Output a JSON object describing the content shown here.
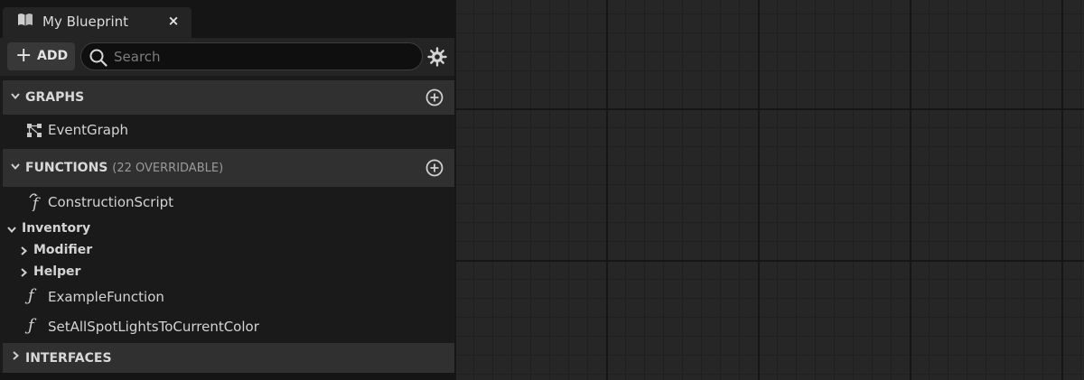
{
  "tab": {
    "title": "My Blueprint",
    "icon": "book-icon",
    "close_label": "×"
  },
  "toolbar": {
    "add_label": "ADD",
    "search_placeholder": "Search",
    "search_value": ""
  },
  "sections": {
    "graphs": {
      "title": "GRAPHS"
    },
    "functions": {
      "title": "FUNCTIONS",
      "subtitle": "(22 OVERRIDABLE)"
    },
    "interfaces": {
      "title": "INTERFACES"
    }
  },
  "graphs": [
    {
      "label": "EventGraph",
      "icon": "event-graph-icon"
    }
  ],
  "functions": {
    "construction_script": "ConstructionScript",
    "categories": {
      "inventory": "Inventory",
      "modifier": "Modifier",
      "helper": "Helper"
    },
    "items": [
      {
        "label": "ExampleFunction",
        "icon": "function-icon"
      },
      {
        "label": "SetAllSpotLightsToCurrentColor",
        "icon": "function-icon"
      }
    ]
  },
  "colors": {
    "panel_bg": "#1a1a1a",
    "section_header_bg": "#303030",
    "canvas_bg": "#262626",
    "search_bg": "#0f0f0f"
  }
}
